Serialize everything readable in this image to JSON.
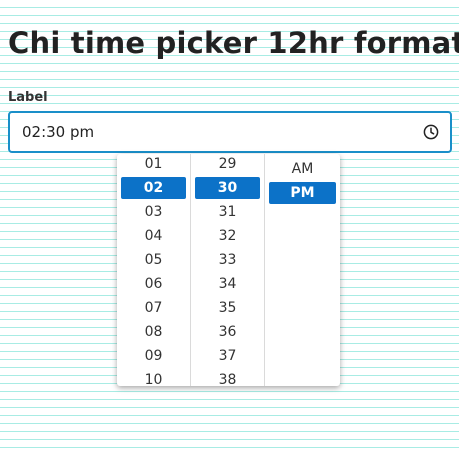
{
  "page": {
    "title": "Chi time picker 12hr format"
  },
  "field": {
    "label": "Label",
    "value": "02:30 pm"
  },
  "picker": {
    "hours": [
      "01",
      "02",
      "03",
      "04",
      "05",
      "06",
      "07",
      "08",
      "09",
      "10"
    ],
    "selected_hour": "02",
    "minutes": [
      "29",
      "30",
      "31",
      "32",
      "33",
      "34",
      "35",
      "36",
      "37",
      "38"
    ],
    "selected_minute": "30",
    "periods": [
      "AM",
      "PM"
    ],
    "selected_period": "PM"
  },
  "icons": {
    "input_icon": "clock-icon"
  },
  "colors": {
    "accent": "#0c72c8",
    "input_border": "#1a8fc9",
    "background_lines": "#a8ece4"
  }
}
